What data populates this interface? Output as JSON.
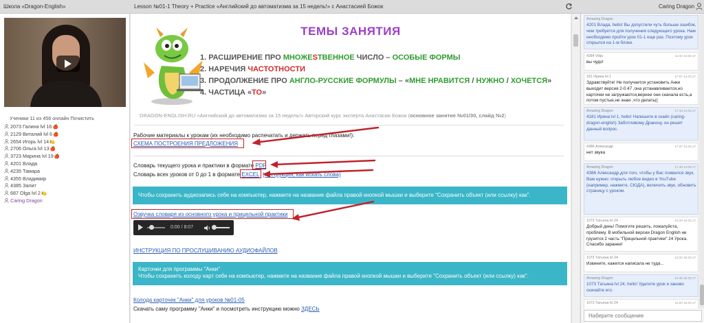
{
  "topbar": {
    "school": "Школа «Dragon-English»",
    "lesson": "Lesson №01-1 Theory + Practice «Английский до автоматизма за 15 недель!» с Анастасией Божок",
    "user": "Caring Dragon"
  },
  "left": {
    "online": "Ученики 11 из 456 онлайн Почистить",
    "users": [
      {
        "label": "2073 Галина lvl 16",
        "mark": "🍎"
      },
      {
        "label": "2129 Виталий lvl 6",
        "mark": "🍎"
      },
      {
        "label": "2654 Игорь lvl 14",
        "mark": "🍋"
      },
      {
        "label": "2706 Ольга lvl 13",
        "mark": "🍎"
      },
      {
        "label": "3723 Марина lvl 19",
        "mark": "🍎"
      },
      {
        "label": "4201 Влада",
        "mark": ""
      },
      {
        "label": "4235 Тамара",
        "mark": ""
      },
      {
        "label": "4355 Владимир",
        "mark": ""
      },
      {
        "label": "4385 Залит",
        "mark": ""
      },
      {
        "label": "687 Olga lvl 2",
        "mark": "🍋"
      },
      {
        "label": "Caring Dragon",
        "mark": ""
      }
    ]
  },
  "slide": {
    "title": "ТЕМЫ ЗАНЯТИЯ",
    "t1a": "1.  РАСШИРЕНИЕ ПРО ",
    "t1b": "МНОЖЕ",
    "t1c": "S",
    "t1d": "ТВЕННОЕ",
    "t1e": " ЧИСЛО – ",
    "t1f": "ОСОБЫЕ ФОРМЫ",
    "t2a": "2.  НАРЕЧИЯ ",
    "t2b": "ЧАСТОТНОСТИ",
    "t3a": "3.  ПРОДОЛЖЕНИЕ ПРО ",
    "t3b": "АНГЛО-РУССКИЕ ФОРМУЛЫ",
    "t3c": " – «",
    "t3d": "МНЕ НРАВИТСЯ",
    "t3e": " / ",
    "t3f": "НУЖНО",
    "t3g": " / ",
    "t3h": "ХОЧЕТСЯ",
    "t3i": "»",
    "t4a": "4.  ЧАСТИЦА «",
    "t4b": "ТО",
    "t4c": "»",
    "footer_a": "DRAGON-ENGLISH.RU «Английский до автоматизма за 15 недель!» Авторский курс эксперта Анастасии Божок (",
    "footer_b": "основное занятие №01/30, слайд №2",
    "footer_c": ")"
  },
  "content": {
    "materials": "Рабочие материалы к урокам (их необходимо распечатать и держать перед глазами!):",
    "scheme_link": "СХЕМА ПОСТРОЕНИЯ ПРЕДЛОЖЕНИЯ",
    "dict_current": "Словарь текущего урока и практики в формате ",
    "pdf_link": "PDF",
    "dict_all": "Словарь всех уроков от 0 до 1 в формате ",
    "excel_link": "EXCEL",
    "instr_link": "(инструкция, как искать слова)",
    "banner1": "Чтобы сохранить аудиозапись себе на компьютер, нажмите на название файла правой кнопкой мышки и выберите \"Сохранить объект (или ссылку) как\".",
    "audio_link": "Озвучка словаря из основного урока и прицельной практики",
    "audio_time": "0:00 / 8:07",
    "listen_link": "ИНСТРУКЦИЯ ПО ПРОСЛУШИВАНИЮ АУДИОФАЙЛОВ",
    "banner2_l1": "Карточки для программы \"Анки\"",
    "banner2_l2": "Чтобы сохранить колоду карт себе на компьютер, нажмите на название файла правой кнопкой мышки и выберите \"Сохранить объект (или ссылку) как\".",
    "anki_link": "Колода карточек \"Анки\" для уроков №01-05",
    "anki_text": "Скачать саму программу \"Анки\" и посмотреть инструкцию можно ",
    "here_link": "ЗДЕСЬ"
  },
  "chat": {
    "placeholder": "Наберите сообщение",
    "messages": [
      {
        "meta": "Amazing Dragon",
        "time": "",
        "text": "4201 Влада, hello! Вы допустили чуть больше ошибок, чем требуется для получения следующего урока. Нам необходимо пройти урок 01-1 еще раз. Поэтому урок открылся на 1-м блоке."
      },
      {
        "meta": "4284 Vilija",
        "time": "11:42 14.03.17",
        "text": "вы чудо!"
      },
      {
        "meta": "181 Ирина lvl 1",
        "time": "17:07 14.03.17",
        "text": "Здравствуйте! Не получается установить Анки выходит версия 2-0.47 ,она устанавливается,но карточки не загружаются,вернее они сначала есть,а потом пустые,не знаю ,что делать(("
      },
      {
        "meta": "Amazing Dragon",
        "time": "17:18 14.03.17",
        "text": "4181 Ирина lvl 1, hello! Напишите в скайп (caring-dragon-english) Заботливому Дракону, он решит данный вопрос."
      },
      {
        "meta": "4386 Александр",
        "time": "17:37 14.03.17",
        "text": "нет звука"
      },
      {
        "meta": "Amazing Dragon",
        "time": "17:48 14.03.17",
        "text": "4386 Александр,для того, чтобы у Вас появился звук, Вам нужно: открыть любое видео в YouTube (например, нажмите, СЮДА), включить звук, обновить страницу с уроком."
      },
      {
        "meta": "1073 Татьяна lvl 24",
        "time": "10:20 15.03.17",
        "text": "Добрый день! Помогите решить, пожалуйста, проблему. В мобильной версии Dragon English не грузится 2 часть \"Прицельной практики\" 24 Урока. Спасибо заранее!"
      },
      {
        "meta": "1073 Татьяна lvl 24",
        "time": "10:32 15.03.17",
        "text": "Извините, кажется написала не туда..."
      },
      {
        "meta": "Amazing Dragon",
        "time": "10:45 15.03.17",
        "text": "1073 Татьяна lvl 24, hello! Удалите урок и заново скачайте его."
      },
      {
        "meta": "1073 Татьяна lvl 24",
        "time": "11:00 15.03.17",
        "text": ""
      }
    ]
  },
  "colors": {
    "accent_banner": "#3bb6c8",
    "title_purple": "#9b3fc7",
    "topic_green": "#2e9c2e",
    "topic_red": "#d42a2a",
    "arrow_red": "#c0232b",
    "link_blue": "#2a5db0"
  }
}
